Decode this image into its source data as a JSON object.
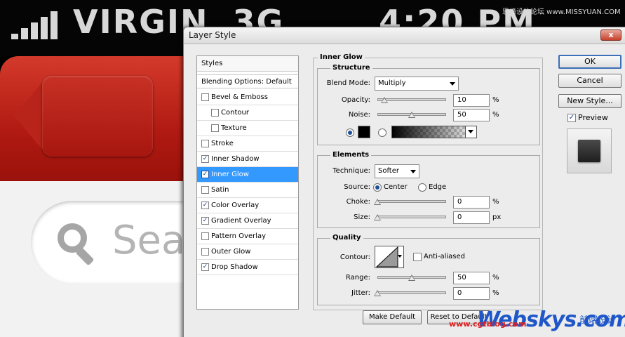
{
  "background": {
    "carrier": "VIRGIN",
    "network": "3G",
    "time": "4:20 PM",
    "search_placeholder": "Sea"
  },
  "dialog": {
    "title": "Layer Style",
    "close_label": "x"
  },
  "styles_list": {
    "header": "Styles",
    "blending_options": "Blending Options: Default",
    "items": [
      {
        "label": "Bevel & Emboss",
        "checked": false,
        "selected": false,
        "indent": false
      },
      {
        "label": "Contour",
        "checked": false,
        "selected": false,
        "indent": true
      },
      {
        "label": "Texture",
        "checked": false,
        "selected": false,
        "indent": true
      },
      {
        "label": "Stroke",
        "checked": false,
        "selected": false,
        "indent": false
      },
      {
        "label": "Inner Shadow",
        "checked": true,
        "selected": false,
        "indent": false
      },
      {
        "label": "Inner Glow",
        "checked": true,
        "selected": true,
        "indent": false
      },
      {
        "label": "Satin",
        "checked": false,
        "selected": false,
        "indent": false
      },
      {
        "label": "Color Overlay",
        "checked": true,
        "selected": false,
        "indent": false
      },
      {
        "label": "Gradient Overlay",
        "checked": true,
        "selected": false,
        "indent": false
      },
      {
        "label": "Pattern Overlay",
        "checked": false,
        "selected": false,
        "indent": false
      },
      {
        "label": "Outer Glow",
        "checked": false,
        "selected": false,
        "indent": false
      },
      {
        "label": "Drop Shadow",
        "checked": true,
        "selected": false,
        "indent": false
      }
    ]
  },
  "inner_glow": {
    "title": "Inner Glow",
    "structure": {
      "legend": "Structure",
      "blend_mode_label": "Blend Mode:",
      "blend_mode_value": "Multiply",
      "opacity_label": "Opacity:",
      "opacity_value": "10",
      "opacity_unit": "%",
      "opacity_level": 0.1,
      "noise_label": "Noise:",
      "noise_value": "50",
      "noise_unit": "%",
      "noise_level": 0.5,
      "color_mode": "solid",
      "glow_color": "#000000"
    },
    "elements": {
      "legend": "Elements",
      "technique_label": "Technique:",
      "technique_value": "Softer",
      "source_label": "Source:",
      "source_center": "Center",
      "source_edge": "Edge",
      "source_selected": "center",
      "choke_label": "Choke:",
      "choke_value": "0",
      "choke_unit": "%",
      "choke_level": 0,
      "size_label": "Size:",
      "size_value": "0",
      "size_unit": "px",
      "size_level": 0
    },
    "quality": {
      "legend": "Quality",
      "contour_label": "Contour:",
      "anti_aliased_label": "Anti-aliased",
      "anti_aliased": false,
      "range_label": "Range:",
      "range_value": "50",
      "range_unit": "%",
      "range_level": 0.5,
      "jitter_label": "Jitter:",
      "jitter_value": "0",
      "jitter_unit": "%",
      "jitter_level": 0
    },
    "make_default": "Make Default",
    "reset_default": "Reset to Default"
  },
  "actions": {
    "ok": "OK",
    "cancel": "Cancel",
    "new_style": "New Style...",
    "preview_label": "Preview",
    "preview_checked": true
  },
  "watermark": {
    "top": "思缘设计论坛 www.MISSYUAN.COM",
    "url": "www.cgtblog.com",
    "logo": "Webskys.com",
    "cn": "前端设计"
  }
}
